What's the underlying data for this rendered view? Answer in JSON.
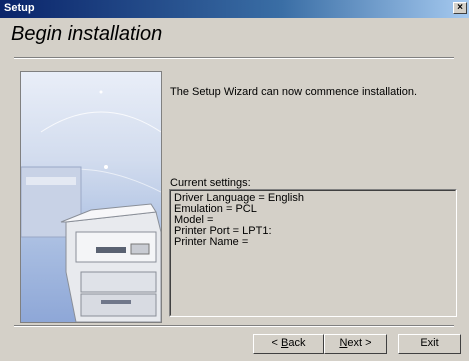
{
  "window": {
    "title": "Setup",
    "close_glyph": "×"
  },
  "header": {
    "title": "Begin installation"
  },
  "main": {
    "message": "The Setup Wizard can now commence installation.",
    "settings_label": "Current settings:",
    "settings": [
      "Driver Language = English",
      "Emulation = PCL",
      "Model =",
      "Printer Port = LPT1:",
      "Printer Name ="
    ]
  },
  "buttons": {
    "back": {
      "mnemonic": "B",
      "rest": "ack",
      "prefix": "< "
    },
    "next": {
      "mnemonic": "N",
      "rest": "ext",
      "suffix": " >"
    },
    "exit": "Exit"
  },
  "colors": {
    "titlebar_start": "#0a246a",
    "face": "#d4d0c8"
  },
  "side_image": {
    "icon": "printer-illustration"
  }
}
